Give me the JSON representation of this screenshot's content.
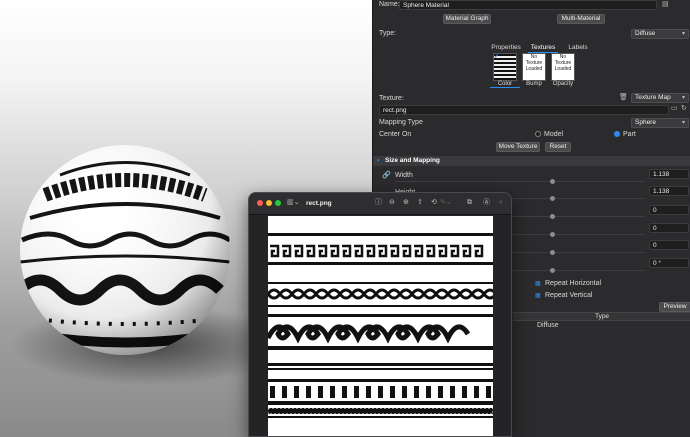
{
  "panel": {
    "name_label": "Name:",
    "name_value": "Sphere Material",
    "material_graph_button": "Material Graph",
    "multi_material_button": "Multi-Material",
    "type_label": "Type:",
    "type_value": "Diffuse",
    "tabs": [
      {
        "label": "Properties",
        "active": false
      },
      {
        "label": "Textures",
        "active": true
      },
      {
        "label": "Labels",
        "active": false
      }
    ],
    "slots": [
      {
        "caption": "Color",
        "status": "",
        "selected": true
      },
      {
        "caption": "Bump",
        "status": "No Texture Loaded",
        "selected": false
      },
      {
        "caption": "Opacity",
        "status": "No Texture Loaded",
        "selected": false
      }
    ],
    "texture_label": "Texture:",
    "texture_map_value": "Texture Map",
    "texture_file": "rect.png",
    "mapping_type_label": "Mapping Type",
    "mapping_type_value": "Sphere",
    "center_on_label": "Center On",
    "center_options": [
      {
        "label": "Model",
        "selected": false
      },
      {
        "label": "Part",
        "selected": true
      }
    ],
    "move_texture_button": "Move Texture",
    "reset_button": "Reset",
    "section_title": "Size and Mapping",
    "width_label": "Width",
    "height_label": "Height",
    "values": [
      "1.138",
      "1.138",
      "0",
      "0",
      "0",
      "0 °"
    ],
    "repeat_horizontal": "Repeat Horizontal",
    "repeat_vertical": "Repeat Vertical",
    "preview_button": "Preview",
    "type_column_header": "Type",
    "type_row_value": "Diffuse",
    "accent_color": "#2d8cf0"
  },
  "preview_window": {
    "title": "rect.png",
    "traffic_lights": [
      "#ff5f57",
      "#febc2e",
      "#28c840"
    ],
    "icons": [
      "sidebar-icon",
      "info-icon",
      "zoom-out-icon",
      "zoom-in-icon",
      "share-icon",
      "rotate-icon",
      "markup-icon",
      "crop-icon",
      "markup-circle-icon",
      "search-icon"
    ]
  },
  "viewport": {
    "object": "patterned-sphere"
  }
}
